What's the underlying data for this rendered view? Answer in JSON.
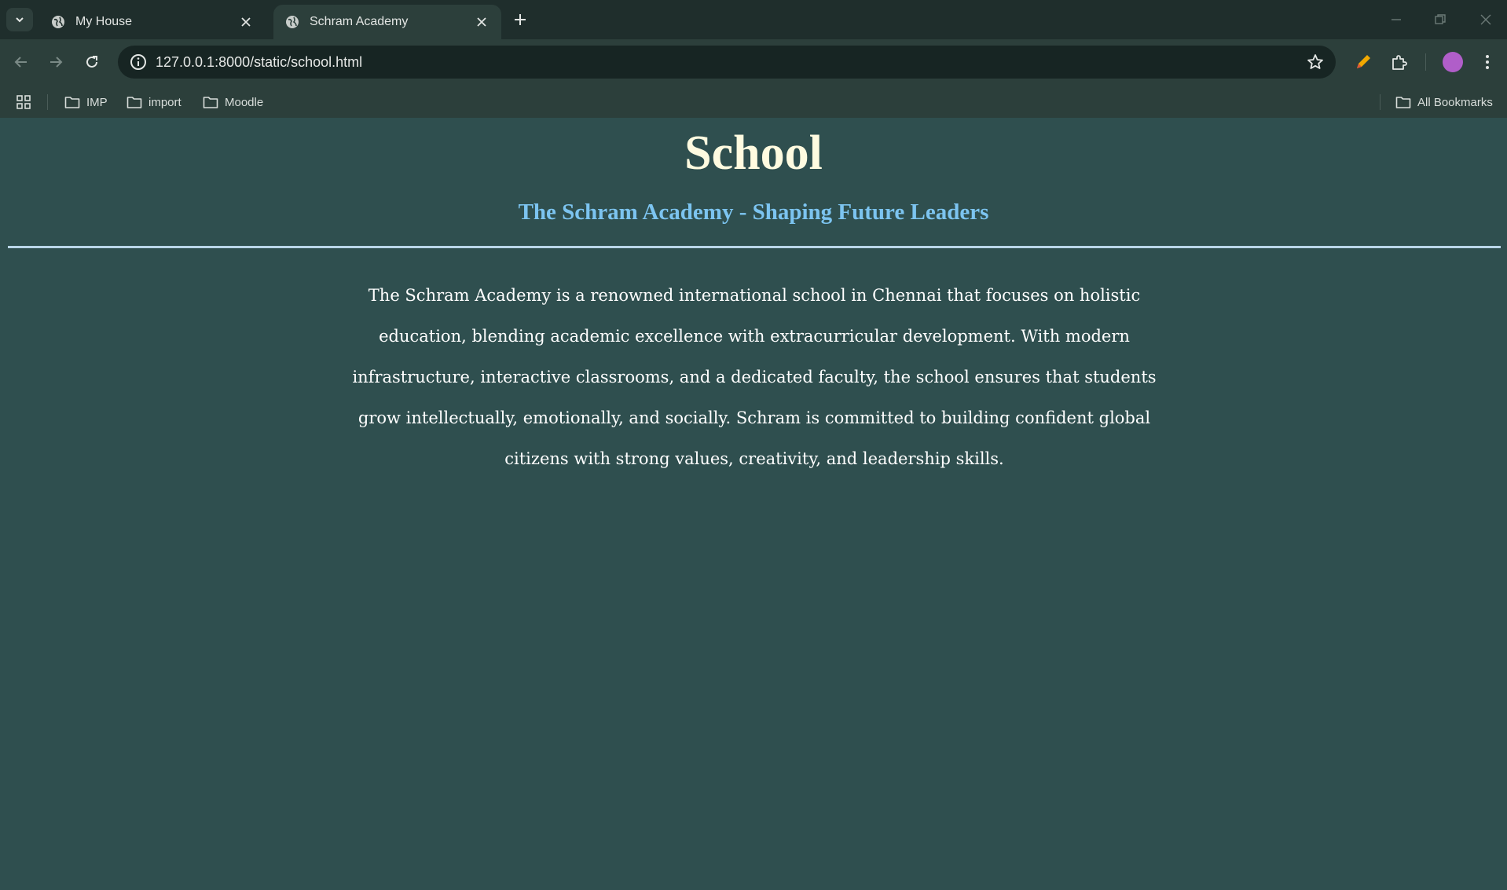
{
  "browser": {
    "tabs": [
      {
        "title": "My House",
        "active": false
      },
      {
        "title": "Schram Academy",
        "active": true
      }
    ],
    "url": "127.0.0.1:8000/static/school.html",
    "bookmarks": [
      "IMP",
      "import",
      "Moodle"
    ],
    "all_bookmarks_label": "All Bookmarks"
  },
  "page": {
    "title": "School",
    "subtitle": "The Schram Academy - Shaping Future Leaders",
    "paragraph": "The Schram Academy is a renowned international school in Chennai that focuses on holistic education, blending academic excellence with extracurricular development. With modern infrastructure, interactive classrooms, and a dedicated faculty, the school ensures that students grow intellectually, emotionally, and socially. Schram is committed to building confident global citizens with strong values, creativity, and leadership skills."
  },
  "colors": {
    "page_background": "#2f4f4f",
    "title": "#fffbe0",
    "subtitle": "#7cc4f0",
    "body_text": "#ffffff",
    "rule": "#b9d6e8"
  }
}
